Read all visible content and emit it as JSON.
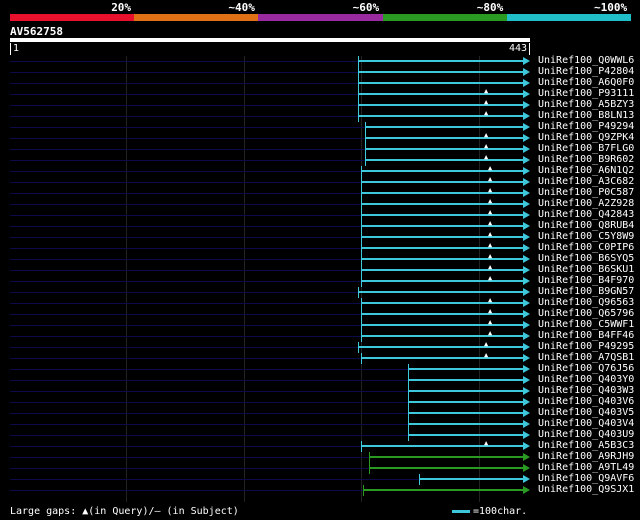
{
  "scale": {
    "labels": [
      "20%",
      "~40%",
      "~60%",
      "~80%",
      "~100%"
    ],
    "colors": [
      "#e8102c",
      "#e07015",
      "#9a2aa0",
      "#2a9a22",
      "#20bec8"
    ]
  },
  "query": {
    "id": "AV562758",
    "start": "1",
    "end": "443",
    "length": 443
  },
  "hits": [
    {
      "name": "UniRef100_Q0WWL6",
      "start": 297,
      "end": 443,
      "color": "#3ec8dc",
      "gap": null
    },
    {
      "name": "UniRef100_P42804",
      "start": 297,
      "end": 443,
      "color": "#3ec8dc",
      "gap": null
    },
    {
      "name": "UniRef100_A6Q0F0",
      "start": 297,
      "end": 443,
      "color": "#3ec8dc",
      "gap": null
    },
    {
      "name": "UniRef100_P93111",
      "start": 297,
      "end": 443,
      "color": "#3ec8dc",
      "gap": 406
    },
    {
      "name": "UniRef100_A5BZY3",
      "start": 297,
      "end": 443,
      "color": "#3ec8dc",
      "gap": 406
    },
    {
      "name": "UniRef100_B8LN13",
      "start": 297,
      "end": 443,
      "color": "#3ec8dc",
      "gap": 406
    },
    {
      "name": "UniRef100_P49294",
      "start": 303,
      "end": 443,
      "color": "#3ec8dc",
      "gap": null
    },
    {
      "name": "UniRef100_Q9ZPK4",
      "start": 303,
      "end": 443,
      "color": "#3ec8dc",
      "gap": 406
    },
    {
      "name": "UniRef100_B7FLG0",
      "start": 303,
      "end": 443,
      "color": "#3ec8dc",
      "gap": 406
    },
    {
      "name": "UniRef100_B9R602",
      "start": 303,
      "end": 443,
      "color": "#3ec8dc",
      "gap": 406
    },
    {
      "name": "UniRef100_A6N1Q2",
      "start": 300,
      "end": 443,
      "color": "#3ec8dc",
      "gap": 410
    },
    {
      "name": "UniRef100_A3C682",
      "start": 300,
      "end": 443,
      "color": "#3ec8dc",
      "gap": 410
    },
    {
      "name": "UniRef100_P0C587",
      "start": 300,
      "end": 443,
      "color": "#3ec8dc",
      "gap": 410
    },
    {
      "name": "UniRef100_A2Z928",
      "start": 300,
      "end": 443,
      "color": "#3ec8dc",
      "gap": 410
    },
    {
      "name": "UniRef100_Q42843",
      "start": 300,
      "end": 443,
      "color": "#3ec8dc",
      "gap": 410
    },
    {
      "name": "UniRef100_Q8RUB4",
      "start": 300,
      "end": 443,
      "color": "#3ec8dc",
      "gap": 410
    },
    {
      "name": "UniRef100_C5Y8W9",
      "start": 300,
      "end": 443,
      "color": "#3ec8dc",
      "gap": 410
    },
    {
      "name": "UniRef100_C0PIP6",
      "start": 300,
      "end": 443,
      "color": "#3ec8dc",
      "gap": 410
    },
    {
      "name": "UniRef100_B6SYQ5",
      "start": 300,
      "end": 443,
      "color": "#3ec8dc",
      "gap": 410
    },
    {
      "name": "UniRef100_B6SKU1",
      "start": 300,
      "end": 443,
      "color": "#3ec8dc",
      "gap": 410
    },
    {
      "name": "UniRef100_B4F970",
      "start": 300,
      "end": 443,
      "color": "#3ec8dc",
      "gap": 410
    },
    {
      "name": "UniRef100_B9GN57",
      "start": 297,
      "end": 443,
      "color": "#3ec8dc",
      "gap": null
    },
    {
      "name": "UniRef100_Q96563",
      "start": 300,
      "end": 443,
      "color": "#3ec8dc",
      "gap": 410
    },
    {
      "name": "UniRef100_Q65796",
      "start": 300,
      "end": 443,
      "color": "#3ec8dc",
      "gap": 410
    },
    {
      "name": "UniRef100_C5WWF1",
      "start": 300,
      "end": 443,
      "color": "#3ec8dc",
      "gap": 410
    },
    {
      "name": "UniRef100_B4FF46",
      "start": 300,
      "end": 443,
      "color": "#3ec8dc",
      "gap": 410
    },
    {
      "name": "UniRef100_P49295",
      "start": 297,
      "end": 443,
      "color": "#3ec8dc",
      "gap": 406
    },
    {
      "name": "UniRef100_A7QSB1",
      "start": 300,
      "end": 443,
      "color": "#3ec8dc",
      "gap": 406
    },
    {
      "name": "UniRef100_Q76J56",
      "start": 340,
      "end": 443,
      "color": "#3ec8dc",
      "gap": null
    },
    {
      "name": "UniRef100_Q403Y0",
      "start": 340,
      "end": 443,
      "color": "#3ec8dc",
      "gap": null
    },
    {
      "name": "UniRef100_Q403W3",
      "start": 340,
      "end": 443,
      "color": "#3ec8dc",
      "gap": null
    },
    {
      "name": "UniRef100_Q403V6",
      "start": 340,
      "end": 443,
      "color": "#3ec8dc",
      "gap": null
    },
    {
      "name": "UniRef100_Q403V5",
      "start": 340,
      "end": 443,
      "color": "#3ec8dc",
      "gap": null
    },
    {
      "name": "UniRef100_Q403V4",
      "start": 340,
      "end": 443,
      "color": "#3ec8dc",
      "gap": null
    },
    {
      "name": "UniRef100_Q403U9",
      "start": 340,
      "end": 443,
      "color": "#3ec8dc",
      "gap": null
    },
    {
      "name": "UniRef100_A5B3C3",
      "start": 300,
      "end": 443,
      "color": "#3ec8dc",
      "gap": 406
    },
    {
      "name": "UniRef100_A9RJH9",
      "start": 307,
      "end": 443,
      "color": "#2a9a22",
      "gap": null
    },
    {
      "name": "UniRef100_A9TL49",
      "start": 307,
      "end": 443,
      "color": "#2a9a22",
      "gap": null
    },
    {
      "name": "UniRef100_Q9AVF6",
      "start": 349,
      "end": 443,
      "color": "#3ec8dc",
      "gap": null
    },
    {
      "name": "UniRef100_Q9SJX1",
      "start": 302,
      "end": 443,
      "color": "#2a9a22",
      "gap": null
    }
  ],
  "footer": {
    "legend": "Large gaps: ▲(in Query)/— (in Subject)",
    "scale_legend": "=100char."
  }
}
